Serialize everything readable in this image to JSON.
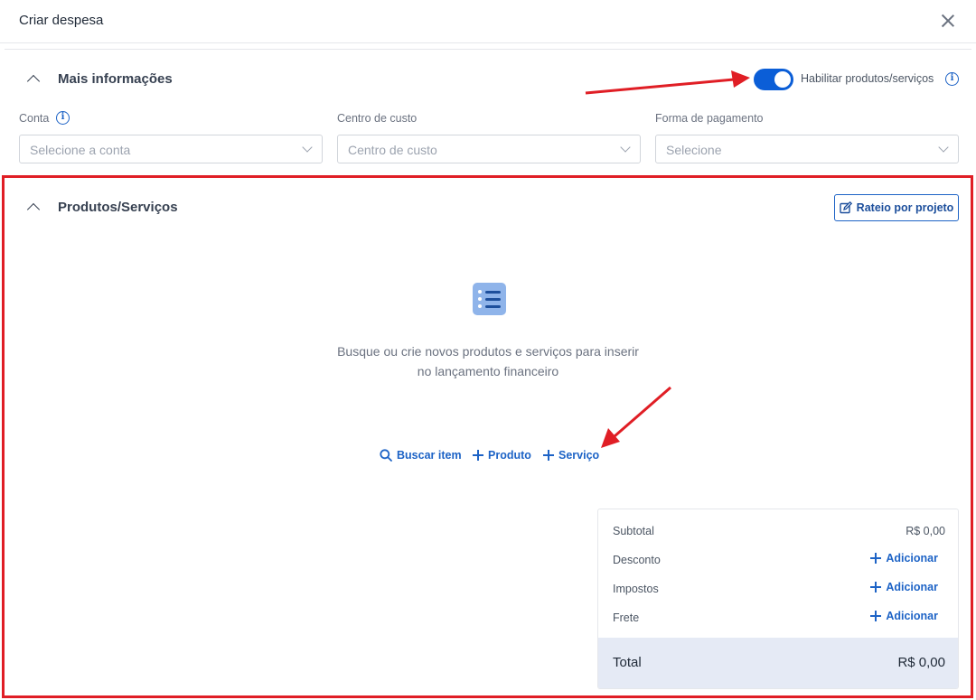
{
  "header": {
    "title": "Criar despesa"
  },
  "more_info": {
    "title": "Mais informações",
    "toggle_label": "Habilitar produtos/serviços",
    "toggle_on": true,
    "fields": [
      {
        "label": "Conta",
        "placeholder": "Selecione a conta"
      },
      {
        "label": "Centro de custo",
        "placeholder": "Centro de custo"
      },
      {
        "label": "Forma de pagamento",
        "placeholder": "Selecione"
      }
    ]
  },
  "products": {
    "title": "Produtos/Serviços",
    "rateio_label": "Rateio por projeto",
    "empty_line1": "Busque ou crie novos produtos e serviços para inserir",
    "empty_line2": "no lançamento financeiro",
    "actions": {
      "search": "Buscar item",
      "product": "Produto",
      "service": "Serviço"
    }
  },
  "summary": {
    "subtotal_label": "Subtotal",
    "subtotal_value": "R$ 0,00",
    "discount_label": "Desconto",
    "taxes_label": "Impostos",
    "freight_label": "Frete",
    "add_label": "Adicionar",
    "total_label": "Total",
    "total_value": "R$ 0,00"
  },
  "colors": {
    "accent": "#1d63c6",
    "highlight": "#e01e25",
    "toggle": "#0b5ed7"
  },
  "icons": [
    "close-icon",
    "chevron-up-icon",
    "info-icon",
    "chevron-down-icon",
    "edit-icon",
    "list-icon",
    "search-icon",
    "plus-icon"
  ]
}
